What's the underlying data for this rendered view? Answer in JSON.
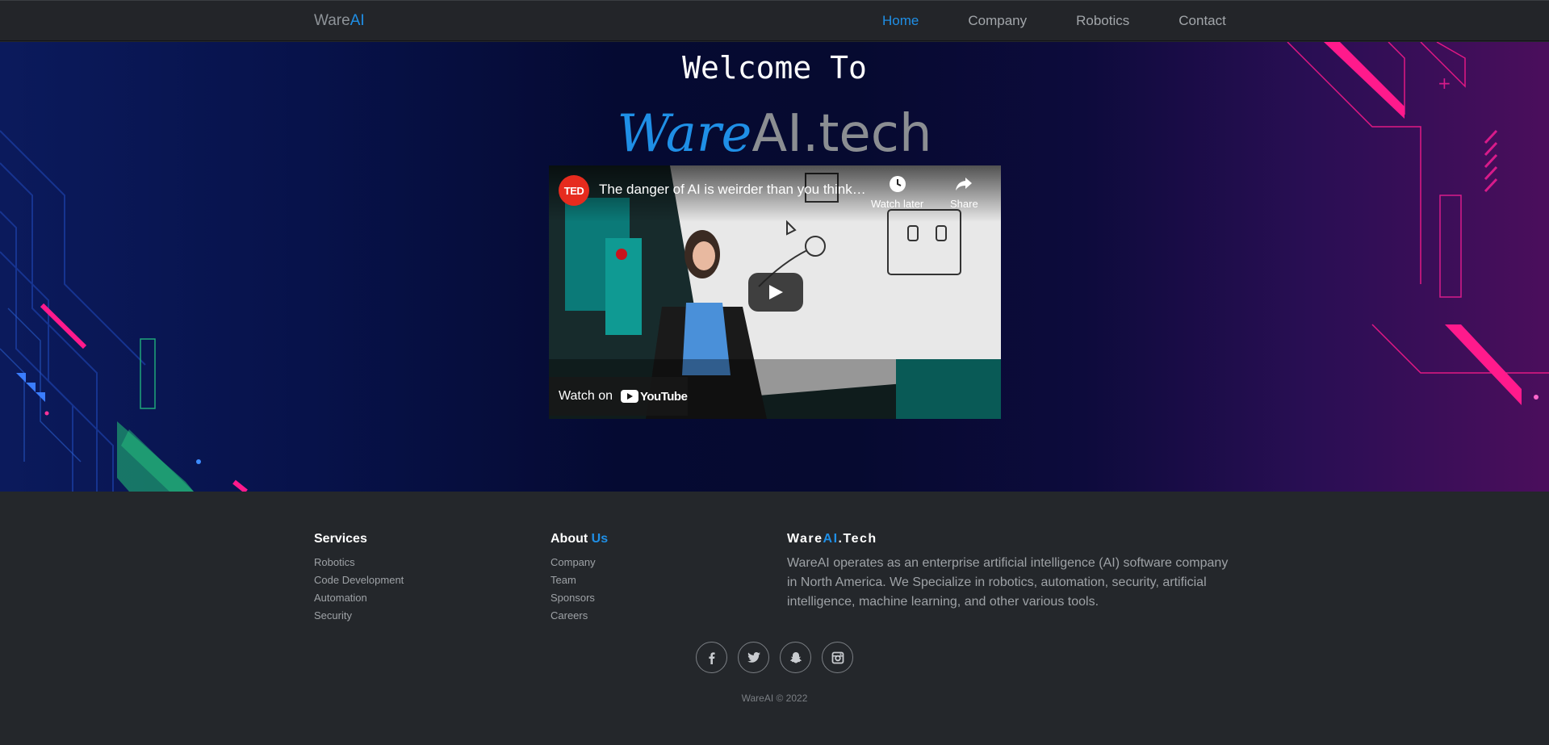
{
  "nav": {
    "brand_prefix": "Ware",
    "brand_accent": "AI",
    "links": [
      "Home",
      "Company",
      "Robotics",
      "Contact"
    ],
    "active": "Home"
  },
  "hero": {
    "welcome": "Welcome To",
    "logo_ware": "Ware",
    "logo_rest": "AI.tech"
  },
  "video": {
    "channel_badge": "TED",
    "title": "The danger of AI is weirder than you think | Janelle Shane",
    "watch_later": "Watch later",
    "share": "Share",
    "watch_on": "Watch on",
    "platform": "YouTube"
  },
  "footer": {
    "services": {
      "title": "Services",
      "items": [
        "Robotics",
        "Code Development",
        "Automation",
        "Security"
      ]
    },
    "about": {
      "title_prefix": "About",
      "title_accent": "Us",
      "items": [
        "Company",
        "Team",
        "Sponsors",
        "Careers"
      ]
    },
    "company": {
      "title_prefix": "Ware",
      "title_accent": "AI",
      "title_suffix": ".Tech",
      "text": "WareAI operates as an enterprise artificial intelligence (AI) software company in North America. We Specialize in robotics, automation, security, artificial intelligence, machine learning, and other various tools."
    },
    "socials": [
      "facebook-icon",
      "twitter-icon",
      "snapchat-icon",
      "instagram-icon"
    ],
    "copyright": "WareAI © 2022"
  },
  "colors": {
    "accent": "#1f8fe6",
    "nav_bg": "#232529",
    "footer_bg": "#24272b",
    "magenta": "#ff1493"
  }
}
